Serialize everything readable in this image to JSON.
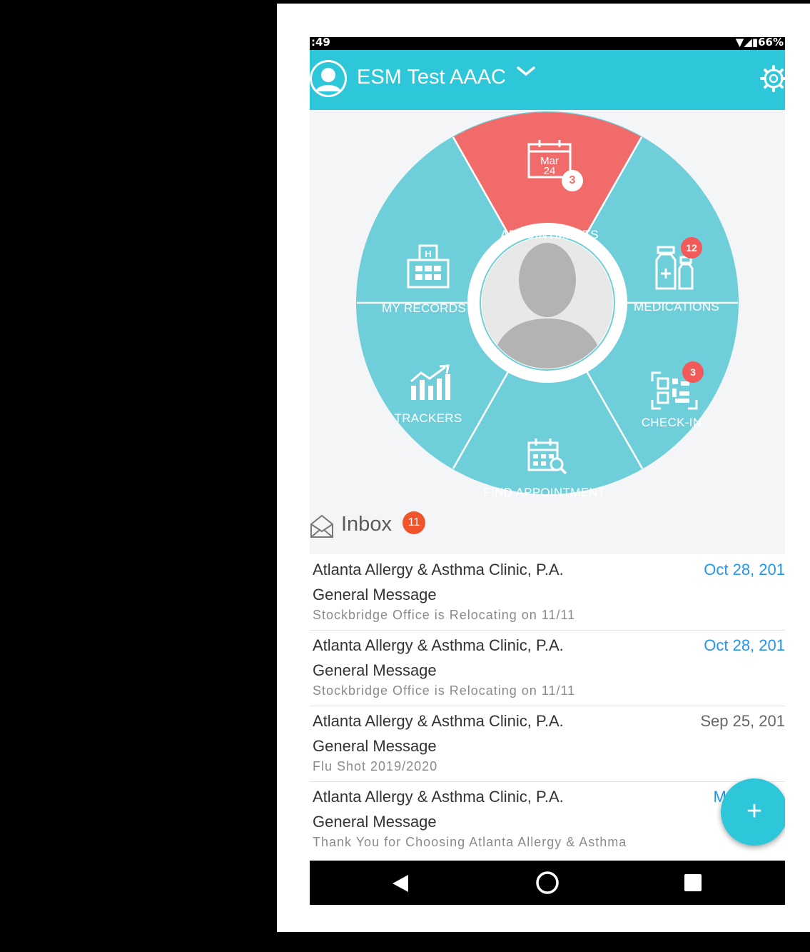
{
  "status_bar": {
    "time": ":49",
    "indicators": "▼◢▮66%"
  },
  "app_bar": {
    "title": "ESM Test AAAC",
    "menu_icon": "chevron-down-icon",
    "settings_icon": "gear-icon"
  },
  "wheel": {
    "segments": [
      {
        "label": "APPOINTMENTS",
        "icon": "calendar-icon",
        "calendar_month": "Mar",
        "calendar_day": "24",
        "badge": "3",
        "color": "#f26b6b"
      },
      {
        "label": "MEDICATIONS",
        "icon": "medication-bottles-icon",
        "badge": "12",
        "color": "#6ecfda"
      },
      {
        "label": "CHECK-IN",
        "icon": "qr-code-icon",
        "badge": "3",
        "color": "#6ecfda"
      },
      {
        "label": "FIND APPOINTMENT",
        "icon": "calendar-search-icon",
        "color": "#6ecfda"
      },
      {
        "label": "TRACKERS",
        "icon": "chart-icon",
        "color": "#6ecfda"
      },
      {
        "label": "MY RECORDS",
        "icon": "hospital-icon",
        "color": "#6ecfda"
      }
    ]
  },
  "inbox": {
    "title": "Inbox",
    "count": "11",
    "messages": [
      {
        "sender": "Atlanta Allergy & Asthma Clinic, P.A.",
        "date": "Oct 28, 201",
        "subject": "General Message",
        "preview": "Stockbridge Office is Relocating on 11/11",
        "unread": true
      },
      {
        "sender": "Atlanta Allergy & Asthma Clinic, P.A.",
        "date": "Oct 28, 201",
        "subject": "General Message",
        "preview": "Stockbridge Office is Relocating on 11/11",
        "unread": true
      },
      {
        "sender": "Atlanta Allergy & Asthma Clinic, P.A.",
        "date": "Sep 25, 201",
        "subject": "General Message",
        "preview": "Flu Shot 2019/2020",
        "unread": false
      },
      {
        "sender": "Atlanta Allergy & Asthma Clinic, P.A.",
        "date": "Ma",
        "subject": "General Message",
        "preview": "Thank You for Choosing Atlanta Allergy & Asthma",
        "unread": true
      }
    ]
  },
  "fab": {
    "label": "+"
  },
  "nav": {
    "back": "back-icon",
    "home": "home-icon",
    "recents": "recents-icon"
  },
  "colors": {
    "accent": "#2ec6d9",
    "unread_date": "#2196f3",
    "read_date": "#666666",
    "badge": "#f25a5a",
    "inbox_badge": "#f0542d"
  }
}
